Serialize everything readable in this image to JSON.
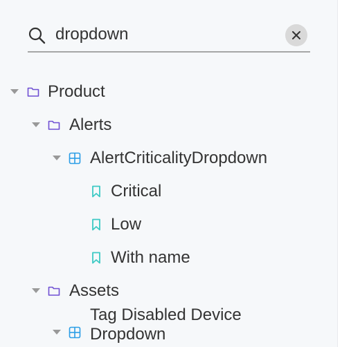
{
  "search": {
    "value": "dropdown",
    "icon": "search-icon",
    "clear_icon": "close-icon"
  },
  "colors": {
    "background": "#f6f8fa",
    "folder": "#6f4fd3",
    "component": "#2a9de6",
    "story": "#3cc9c4",
    "text": "#333333"
  },
  "tree": {
    "product": "Product",
    "alerts": "Alerts",
    "alert_dropdown": "AlertCriticalityDropdown",
    "story_critical": "Critical",
    "story_low": "Low",
    "story_with_name": "With name",
    "assets": "Assets",
    "tag_disabled": "Tag Disabled Device Dropdown"
  }
}
